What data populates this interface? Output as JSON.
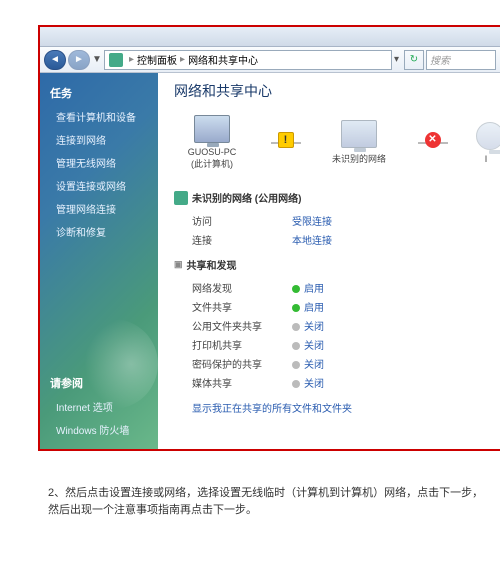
{
  "breadcrumb": {
    "root_icon": "monitor-icon",
    "item1": "控制面板",
    "item2": "网络和共享中心"
  },
  "search": {
    "placeholder": "搜索"
  },
  "sidebar": {
    "tasks_head": "任务",
    "items": [
      "查看计算机和设备",
      "连接到网络",
      "管理无线网络",
      "设置连接或网络",
      "管理网络连接",
      "诊断和修复"
    ],
    "seealso_head": "请参阅",
    "seealso": [
      "Internet 选项",
      "Windows 防火墙"
    ]
  },
  "main": {
    "title": "网络和共享中心",
    "map": {
      "pc_name": "GUOSU-PC",
      "pc_sub": "(此计算机)",
      "net_name": "未识别的网络",
      "inet_name": "I"
    },
    "unknown_head": "未识别的网络 (公用网络)",
    "rows1": [
      {
        "label": "访问",
        "value": "受限连接"
      },
      {
        "label": "连接",
        "value": "本地连接"
      }
    ],
    "share_head": "共享和发现",
    "rows2": [
      {
        "label": "网络发现",
        "value": "启用",
        "state": "on"
      },
      {
        "label": "文件共享",
        "value": "启用",
        "state": "on"
      },
      {
        "label": "公用文件夹共享",
        "value": "关闭",
        "state": "off"
      },
      {
        "label": "打印机共享",
        "value": "关闭",
        "state": "off"
      },
      {
        "label": "密码保护的共享",
        "value": "关闭",
        "state": "off"
      },
      {
        "label": "媒体共享",
        "value": "关闭",
        "state": "off"
      }
    ],
    "link1": "显示我正在共享的所有文件和文件夹"
  },
  "doc": {
    "line1": "2、然后点击设置连接或网络，选择设置无线临时（计算机到计算机）网络，点击下一步，",
    "line2": "然后出现一个注意事项指南再点击下一步。"
  }
}
